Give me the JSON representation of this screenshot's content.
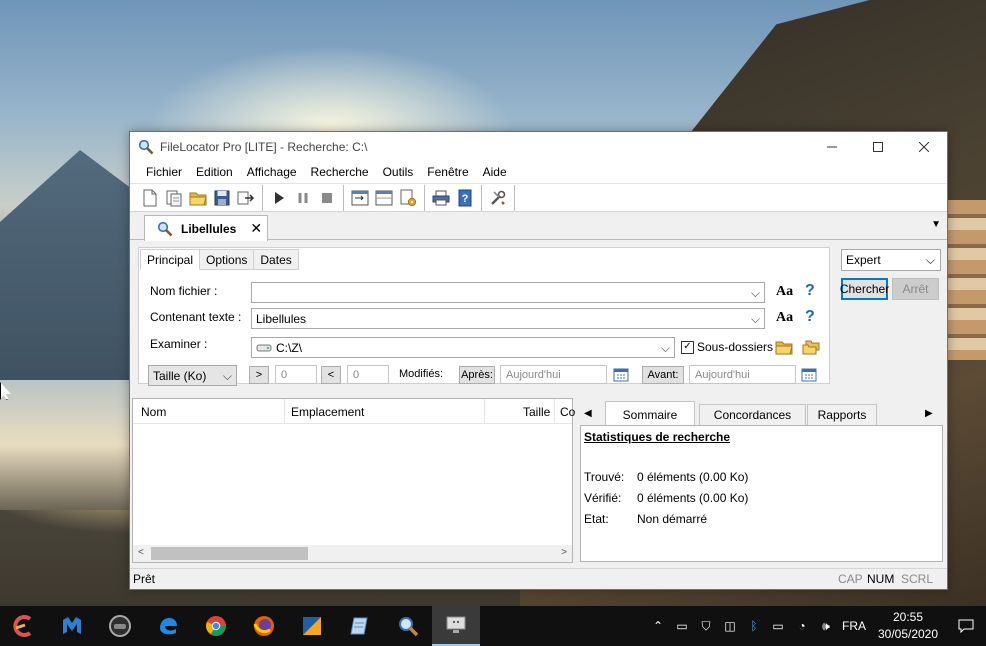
{
  "window": {
    "title": "FileLocator Pro [LITE] - Recherche: C:\\",
    "minimize_glyph": "—",
    "maximize_glyph": "☐",
    "close_glyph": "✕"
  },
  "menu": [
    "Fichier",
    "Edition",
    "Affichage",
    "Recherche",
    "Outils",
    "Fenêtre",
    "Aide"
  ],
  "doc_tab": {
    "label": "Libellules",
    "close_glyph": "✕"
  },
  "criteria": {
    "tabs": [
      "Principal",
      "Options",
      "Dates"
    ],
    "file_name_label": "Nom fichier :",
    "file_name_value": "",
    "containing_text_label": "Contenant texte :",
    "containing_text_value": "Libellules",
    "look_in_label": "Examiner :",
    "look_in_value": "C:\\Z\\",
    "subfolders_label": "Sous-dossiers",
    "subfolders_checked": true,
    "case_label": "Aa",
    "help_label": "?",
    "size_select": "Taille (Ko)",
    "gt_label": ">",
    "gt_value": "0",
    "lt_label": "<",
    "lt_value": "0",
    "modified_label": "Modifiés:",
    "after_label": "Après:",
    "after_value": "Aujourd'hui",
    "before_label": "Avant:",
    "before_value": "Aujourd'hui"
  },
  "actions": {
    "mode": "Expert",
    "search_label": "Chercher",
    "stop_label": "Arrêt"
  },
  "results": {
    "columns": [
      "Nom",
      "Emplacement",
      "Taille",
      "Co"
    ]
  },
  "summary_panel": {
    "tabs": [
      "Sommaire",
      "Concordances",
      "Rapports"
    ],
    "title": "Statistiques de recherche",
    "rows": [
      {
        "key": "Trouvé:",
        "value": "0 éléments (0.00 Ko)"
      },
      {
        "key": "Vérifié:",
        "value": "0 éléments (0.00 Ko)"
      },
      {
        "key": "Etat:",
        "value": "Non démarré"
      }
    ]
  },
  "status": {
    "text": "Prêt",
    "indicators": [
      {
        "label": "CAP",
        "active": false
      },
      {
        "label": "NUM",
        "active": true
      },
      {
        "label": "SCRL",
        "active": false
      }
    ]
  },
  "taskbar": {
    "apps": [
      "malwarebytes-icon",
      "photo-icon",
      "edge-icon",
      "chrome-icon",
      "firefox-icon",
      "app-icon",
      "notebook-icon",
      "filelocator-icon",
      "display-icon"
    ],
    "lang": "FRA",
    "time": "20:55",
    "date": "30/05/2020"
  },
  "colors": {
    "accent": "#0078d7",
    "help": "#1b66c9",
    "taskbar": "#101010"
  }
}
